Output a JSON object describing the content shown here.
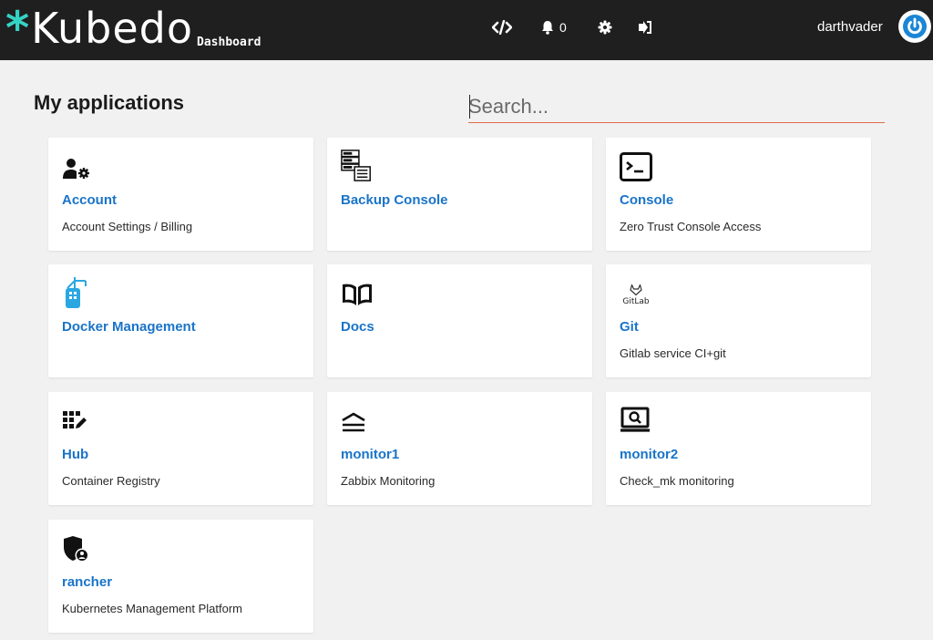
{
  "header": {
    "brand_star": "*",
    "brand_name": "Kubedo",
    "brand_sub": "Dashboard",
    "notification_count": "0",
    "username": "darthvader"
  },
  "main": {
    "title": "My applications",
    "search_placeholder": "Search...",
    "apps": [
      {
        "name": "Account",
        "description": "Account Settings / Billing",
        "icon": "user-gear-icon"
      },
      {
        "name": "Backup Console",
        "description": "",
        "icon": "server-backup-icon"
      },
      {
        "name": "Console",
        "description": "Zero Trust Console Access",
        "icon": "terminal-icon"
      },
      {
        "name": "Docker Management",
        "description": "",
        "icon": "docker-icon"
      },
      {
        "name": "Docs",
        "description": "",
        "icon": "book-icon"
      },
      {
        "name": "Git",
        "description": "Gitlab service CI+git",
        "icon": "gitlab-icon",
        "icon_text": "GitLab"
      },
      {
        "name": "Hub",
        "description": "Container Registry",
        "icon": "registry-grid-icon"
      },
      {
        "name": "monitor1",
        "description": "Zabbix Monitoring",
        "icon": "stack-lines-icon"
      },
      {
        "name": "monitor2",
        "description": "Check_mk monitoring",
        "icon": "monitor-search-icon"
      },
      {
        "name": "rancher",
        "description": "Kubernetes Management Platform",
        "icon": "shield-user-icon"
      }
    ]
  },
  "colors": {
    "header_bg": "#1f1f1f",
    "accent_teal": "#35d3c5",
    "link_blue": "#1a74c9",
    "search_underline": "#e0694e",
    "power_blue": "#1a86d6"
  }
}
